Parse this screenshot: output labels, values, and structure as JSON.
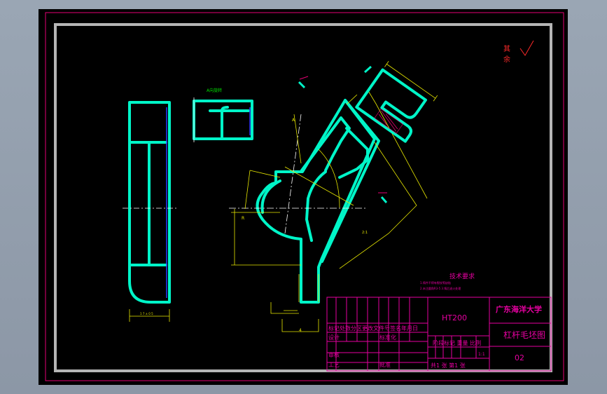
{
  "surface_roughness": {
    "label_top": "其",
    "label_bottom": "余"
  },
  "view_labels": {
    "section": "A向旋转"
  },
  "tech_requirements": {
    "title": "技术要求",
    "line1": "1.铸件不得有裂纹等缺陷",
    "line2": "2.未注圆角R3-5  3.铸后退火处理"
  },
  "title_block": {
    "material": "HT200",
    "university": "广东海洋大学",
    "drawing_name": "杠杆毛坯图",
    "drawing_number": "02",
    "change_header": "标记处数分区更改文件号签名年月日",
    "row_design": "设计",
    "row_standard": "标准化",
    "row_review": "审核",
    "row_process": "工艺",
    "row_approve": "批准",
    "stage_header": "阶段标记 重量 比例",
    "scale": "1:1",
    "sheet_info": "共1 张 第1 张"
  },
  "dimension_labels": [
    "A",
    "R",
    "2:1",
    "4"
  ]
}
